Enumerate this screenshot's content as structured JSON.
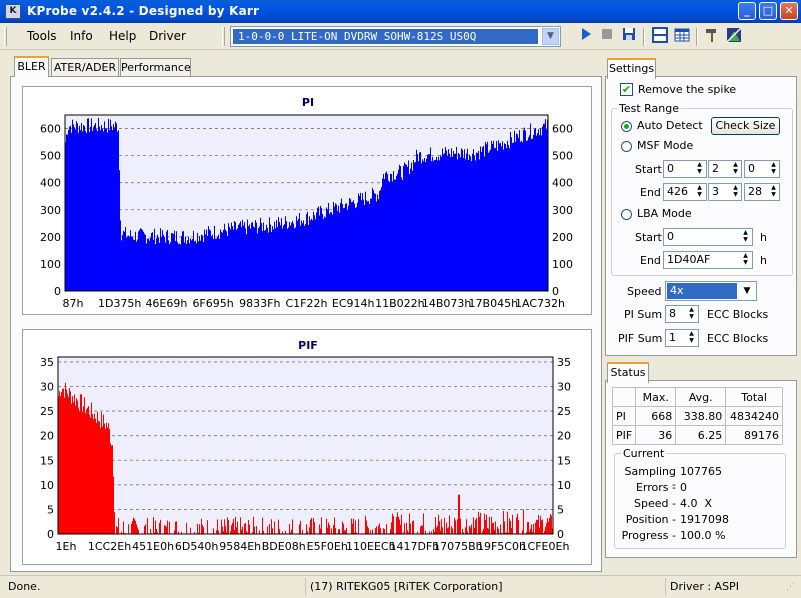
{
  "window": {
    "title": "KProbe v2.4.2 - Designed by Karr"
  },
  "menu": {
    "items": [
      {
        "label": "Tools"
      },
      {
        "label": "Info"
      },
      {
        "label": "Help"
      },
      {
        "label": "Driver"
      }
    ]
  },
  "drive": {
    "selected": "1-0-0-0 LITE-ON DVDRW SOHW-812S  US0Q"
  },
  "tabs": [
    {
      "label": "BLER",
      "active": true
    },
    {
      "label": "ATER/ADER",
      "active": false
    },
    {
      "label": "Performance",
      "active": false
    }
  ],
  "chart_data": [
    {
      "type": "bar",
      "title": "PI",
      "color": "#0000ff",
      "ylim": [
        0,
        650
      ],
      "yticks": [
        0,
        100,
        200,
        300,
        400,
        500,
        600
      ],
      "xticklabels": [
        "87h",
        "1D375h",
        "46E69h",
        "6F695h",
        "9833Fh",
        "C1F22h",
        "EC914h",
        "11B022h",
        "14B073h",
        "17B045h",
        "1AC732h"
      ],
      "profile_x": [
        0,
        0.005,
        0.11,
        0.115,
        0.13,
        0.25,
        0.35,
        0.45,
        0.5,
        0.6,
        0.65,
        0.66,
        0.7,
        0.72,
        0.73,
        0.8,
        0.85,
        0.9,
        0.95,
        1.0
      ],
      "profile_y": [
        550,
        610,
        610,
        215,
        205,
        200,
        230,
        250,
        270,
        330,
        360,
        430,
        440,
        470,
        500,
        510,
        510,
        540,
        580,
        610
      ]
    },
    {
      "type": "bar",
      "title": "PIF",
      "color": "#ff0000",
      "ylim": [
        0,
        36
      ],
      "yticks": [
        0,
        5,
        10,
        15,
        20,
        25,
        30,
        35
      ],
      "xticklabels": [
        "1Eh",
        "1CC2Eh",
        "451E0h",
        "6D540h",
        "9584Eh",
        "BDE08h",
        "E5F0Eh",
        "110EECh",
        "1417DFh",
        "17075Bh",
        "19F5C0h",
        "1CFE0Eh"
      ],
      "profile_x": [
        0,
        0.005,
        0.1,
        0.11,
        0.115,
        0.6,
        0.65,
        0.7,
        0.8,
        0.9,
        1.0
      ],
      "profile_y": [
        28,
        30,
        22,
        18,
        0.5,
        0.6,
        1.2,
        1.5,
        1.6,
        1.8,
        2.2
      ]
    }
  ],
  "settings": {
    "tab_label": "Settings",
    "remove_spike": "Remove the spike",
    "test_range_label": "Test Range",
    "auto_detect": "Auto Detect",
    "check_size": "Check Size",
    "msf_mode": "MSF Mode",
    "start_label": "Start",
    "end_label": "End",
    "msf_start": [
      "0",
      "2",
      "0"
    ],
    "msf_end": [
      "426",
      "3",
      "28"
    ],
    "lba_mode": "LBA Mode",
    "lba_start": "0",
    "lba_end": "1D40AF",
    "unit_h": "h",
    "speed_label": "Speed",
    "speed_value": "4x",
    "pi_sum_label": "PI Sum",
    "pi_sum_value": "8",
    "pif_sum_label": "PIF Sum",
    "pif_sum_value": "1",
    "ecc_blocks": "ECC Blocks"
  },
  "status": {
    "tab_label": "Status",
    "headers": [
      "Max.",
      "Avg.",
      "Total"
    ],
    "rows": [
      {
        "label": "PI",
        "max": "668",
        "avg": "338.80",
        "total": "4834240"
      },
      {
        "label": "PIF",
        "max": "36",
        "avg": "6.25",
        "total": "89176"
      }
    ],
    "current_label": "Current",
    "sampling_label": "Sampling -",
    "sampling_value": "107765",
    "errors_label": "Errors -",
    "errors_value": "0",
    "speed_label": "Speed -",
    "speed_value": "4.0  X",
    "position_label": "Position -",
    "position_value": "1917098",
    "progress_label": "Progress -",
    "progress_value": "100.0 %"
  },
  "statusbar": {
    "left": "Done.",
    "middle": "(17) RITEKG05 [RiTEK Corporation]",
    "right": "Driver : ASPI"
  }
}
